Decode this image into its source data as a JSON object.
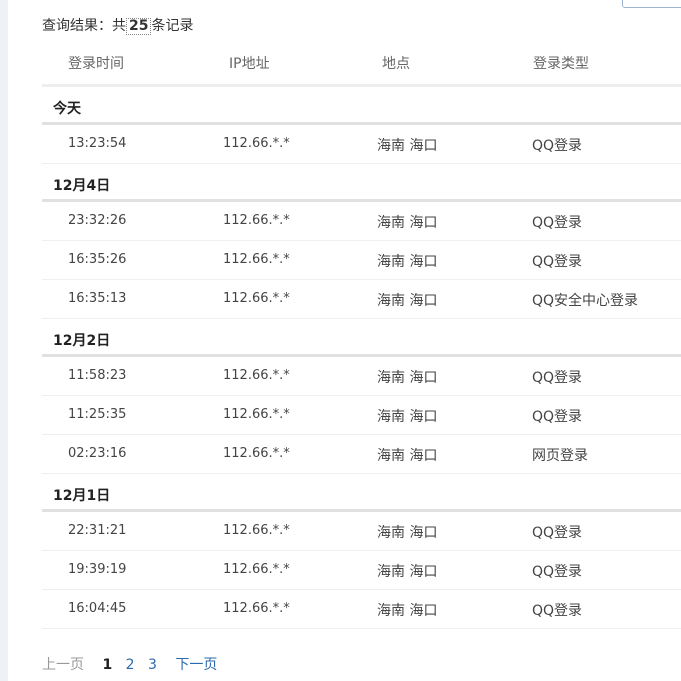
{
  "summary": {
    "prefix": "查询结果：共",
    "count": "25",
    "suffix": "条记录"
  },
  "columns": {
    "time": "登录时间",
    "ip": "IP地址",
    "location": "地点",
    "type": "登录类型"
  },
  "groups": [
    {
      "date": "今天",
      "rows": [
        {
          "time": "13:23:54",
          "ip": "112.66.*.*",
          "location": "海南 海口",
          "type": "QQ登录"
        }
      ]
    },
    {
      "date": "12月4日",
      "rows": [
        {
          "time": "23:32:26",
          "ip": "112.66.*.*",
          "location": "海南 海口",
          "type": "QQ登录"
        },
        {
          "time": "16:35:26",
          "ip": "112.66.*.*",
          "location": "海南 海口",
          "type": "QQ登录"
        },
        {
          "time": "16:35:13",
          "ip": "112.66.*.*",
          "location": "海南 海口",
          "type": "QQ安全中心登录"
        }
      ]
    },
    {
      "date": "12月2日",
      "rows": [
        {
          "time": "11:58:23",
          "ip": "112.66.*.*",
          "location": "海南 海口",
          "type": "QQ登录"
        },
        {
          "time": "11:25:35",
          "ip": "112.66.*.*",
          "location": "海南 海口",
          "type": "QQ登录"
        },
        {
          "time": "02:23:16",
          "ip": "112.66.*.*",
          "location": "海南 海口",
          "type": "网页登录"
        }
      ]
    },
    {
      "date": "12月1日",
      "rows": [
        {
          "time": "22:31:21",
          "ip": "112.66.*.*",
          "location": "海南 海口",
          "type": "QQ登录"
        },
        {
          "time": "19:39:19",
          "ip": "112.66.*.*",
          "location": "海南 海口",
          "type": "QQ登录"
        },
        {
          "time": "16:04:45",
          "ip": "112.66.*.*",
          "location": "海南 海口",
          "type": "QQ登录"
        }
      ]
    }
  ],
  "pagination": {
    "prev": "上一页",
    "current": "1",
    "pages": [
      "2",
      "3"
    ],
    "next": "下一页"
  }
}
